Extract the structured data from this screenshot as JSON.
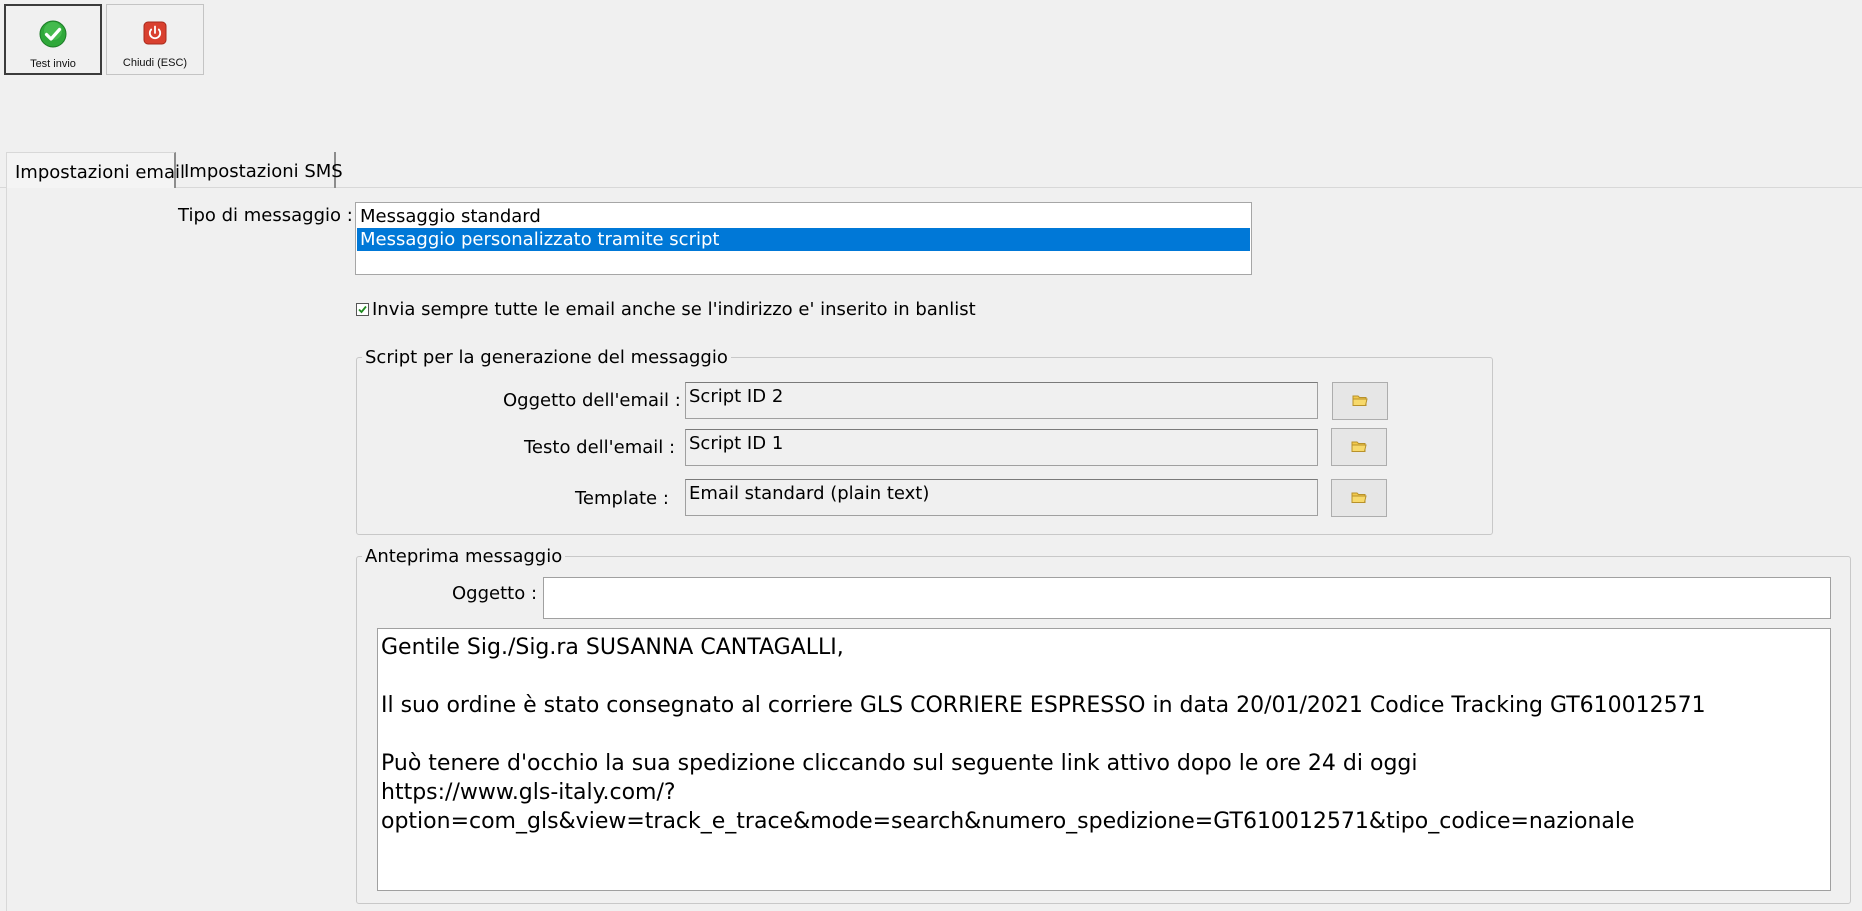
{
  "toolbar": {
    "test_label": "Test invio",
    "close_label": "Chiudi (ESC)"
  },
  "tabs": [
    {
      "label": "Impostazioni email",
      "selected": true
    },
    {
      "label": "Impostazioni SMS",
      "selected": false
    }
  ],
  "message_type": {
    "label": "Tipo di messaggio :",
    "options": [
      "Messaggio standard",
      "Messaggio personalizzato tramite script"
    ],
    "selected_index": 1
  },
  "banlist_checkbox": {
    "label": "Invia sempre tutte le email anche se l'indirizzo e' inserito in banlist",
    "checked": true
  },
  "script_group": {
    "title": "Script per la generazione del messaggio",
    "subject": {
      "label": "Oggetto dell'email :",
      "value": "Script ID 2"
    },
    "body": {
      "label": "Testo dell'email :",
      "value": "Script ID 1"
    },
    "template": {
      "label": "Template :",
      "value": "Email standard (plain text)"
    }
  },
  "preview_group": {
    "title": "Anteprima messaggio",
    "subject_label": "Oggetto :",
    "subject_value": "",
    "body_text": "Gentile Sig./Sig.ra SUSANNA CANTAGALLI,\n\nIl suo ordine è stato consegnato al corriere GLS CORRIERE ESPRESSO in data 20/01/2021 Codice Tracking GT610012571\n\nPuò tenere d'occhio la sua spedizione cliccando sul seguente link attivo dopo le ore 24 di oggi\nhttps://www.gls-italy.com/?\noption=com_gls&view=track_e_trace&mode=search&numero_spedizione=GT610012571&tipo_codice=nazionale"
  },
  "icons": {
    "test": "check-circle-icon",
    "close": "power-icon",
    "browse": "folder-icon"
  },
  "colors": {
    "selection": "#0078d7",
    "check_green": "#2fa83a",
    "close_red": "#d9402f"
  }
}
